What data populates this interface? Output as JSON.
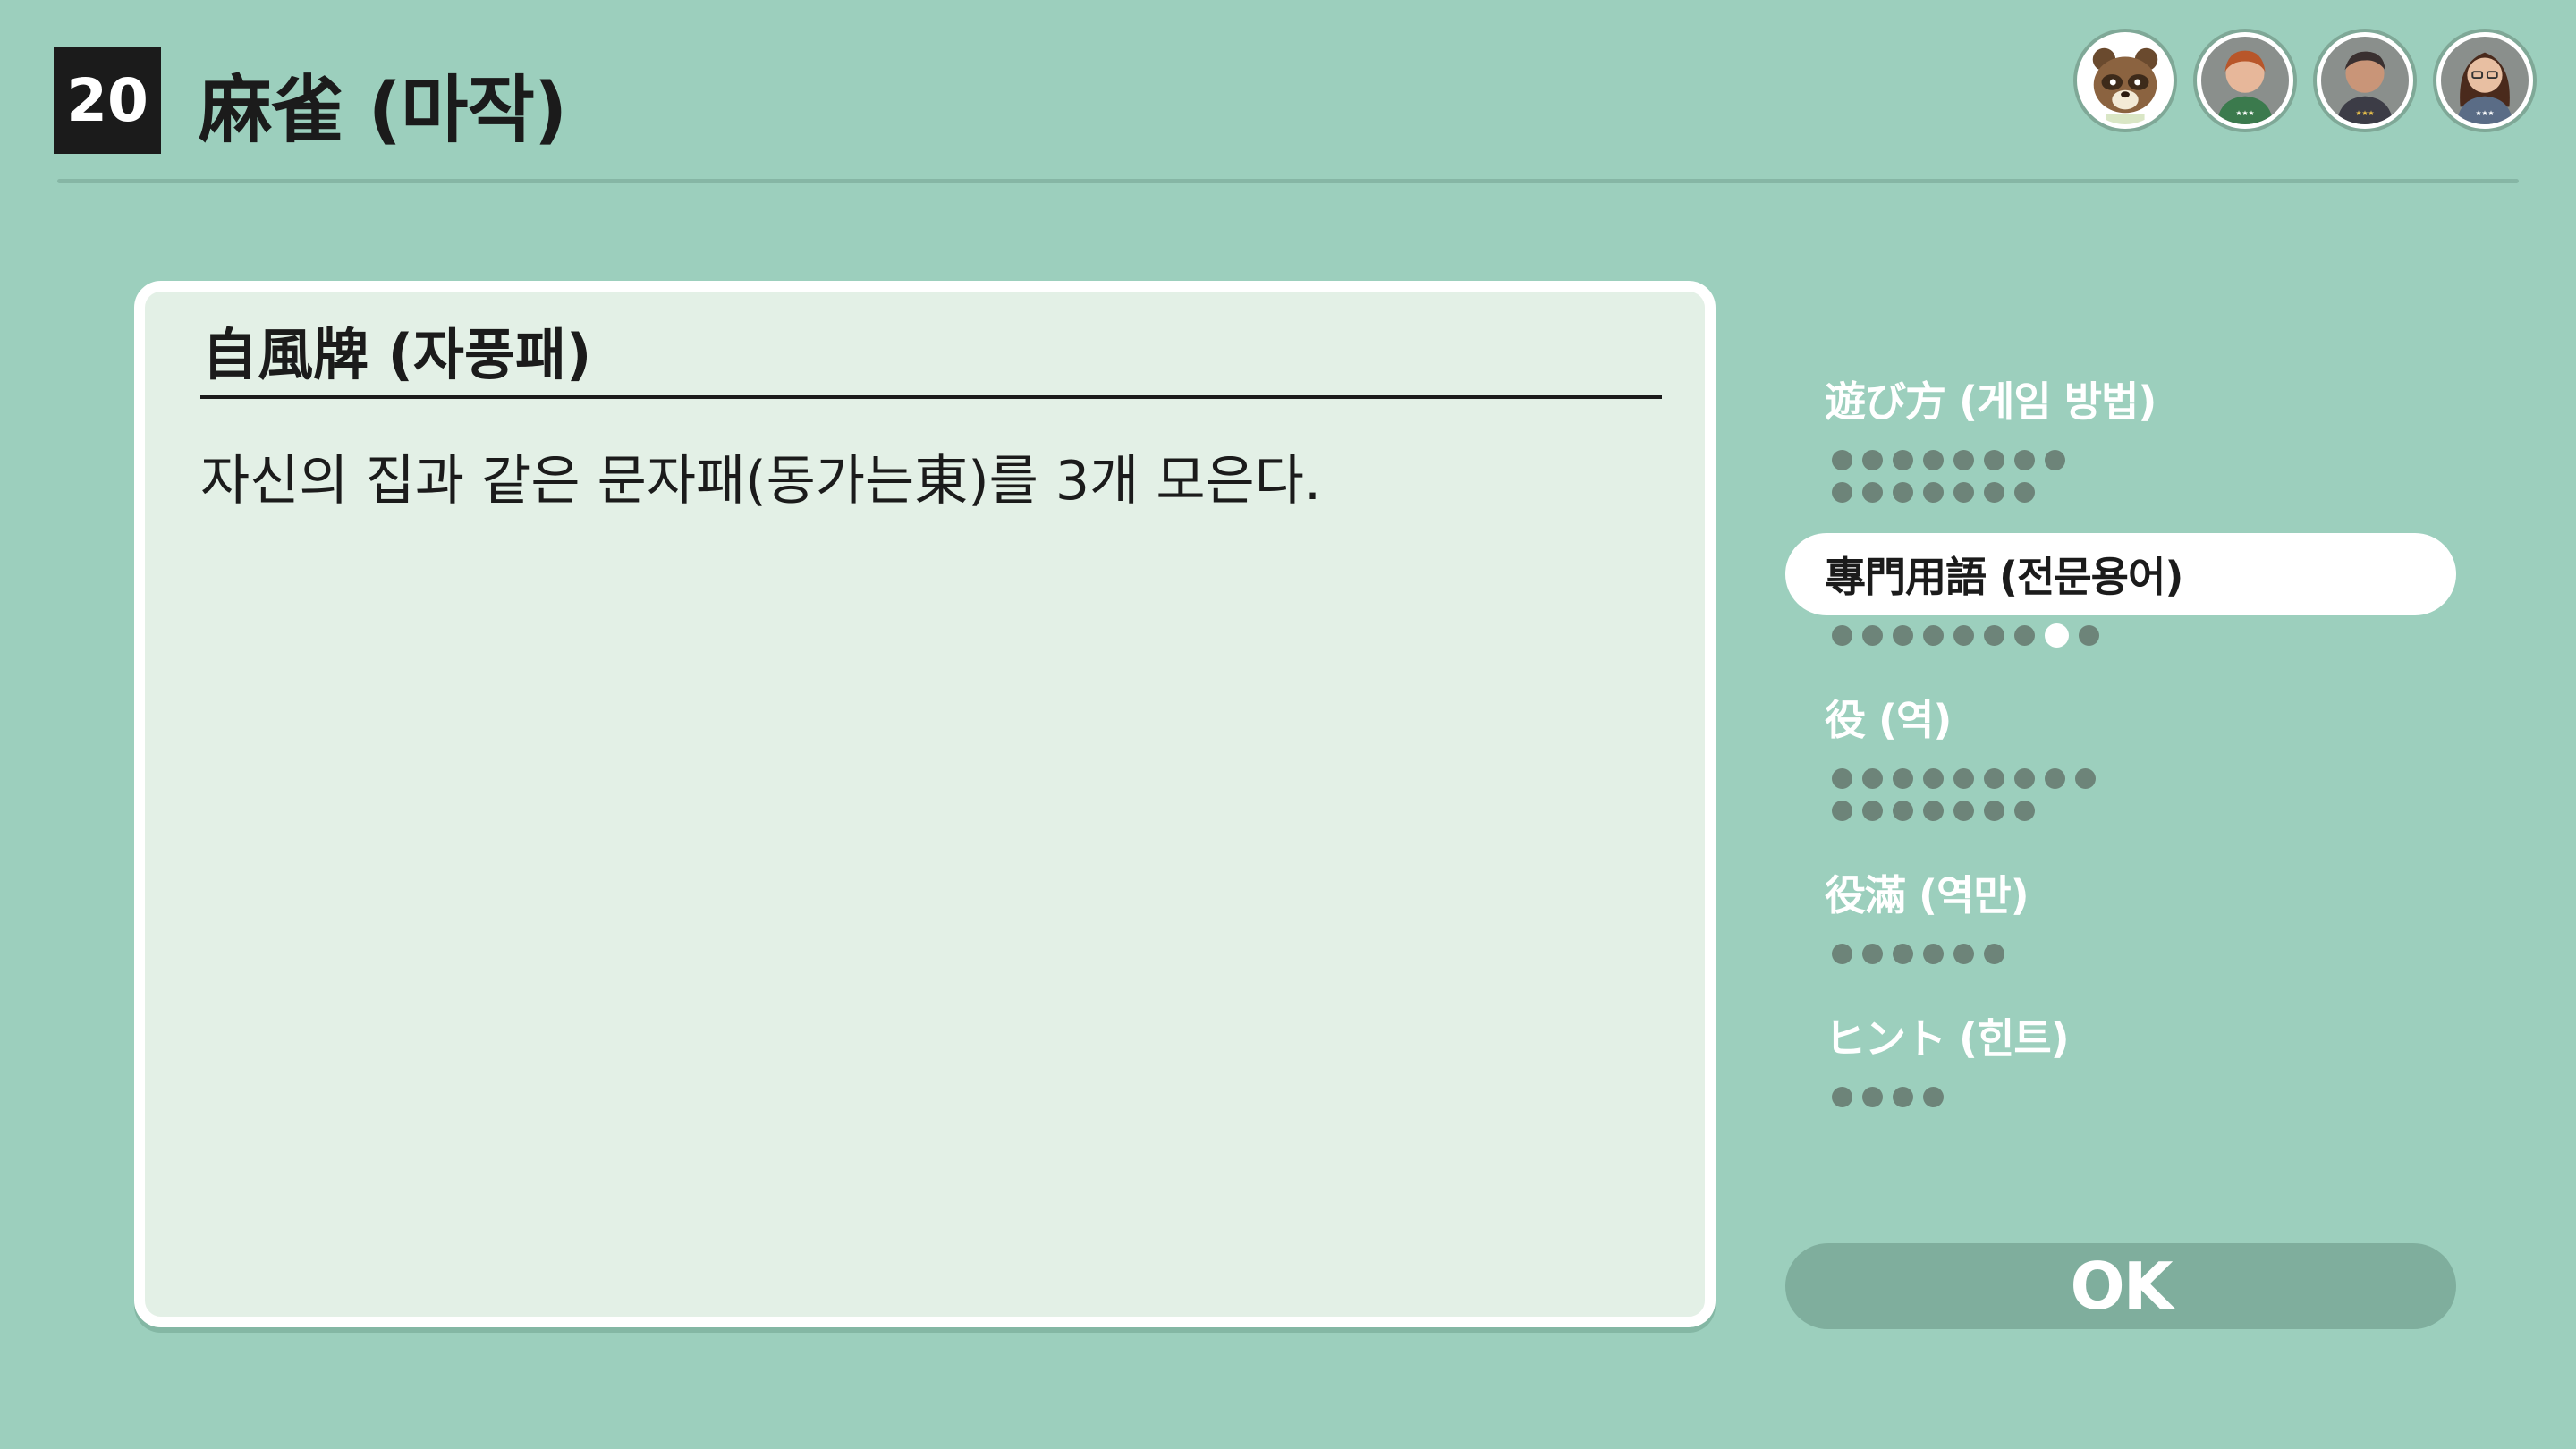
{
  "header": {
    "number": "20",
    "title": "麻雀 (마작)"
  },
  "players": [
    {
      "name": "raccoon-player-avatar-icon"
    },
    {
      "name": "cpu-player-avatar-icon"
    },
    {
      "name": "cpu-player-avatar-icon"
    },
    {
      "name": "cpu-player-avatar-icon"
    }
  ],
  "panel": {
    "title": "自風牌 (자풍패)",
    "body": "자신의 집과 같은 문자패(동가는東)를 3개 모은다."
  },
  "menu": {
    "items": [
      {
        "label": "遊び方 (게임 방법)",
        "active": false,
        "dot_rows": [
          8,
          7
        ],
        "current_dot": null
      },
      {
        "label": "專門用語 (전문용어)",
        "active": true,
        "dot_rows": [
          9
        ],
        "current_dot": 7
      },
      {
        "label": "役 (역)",
        "active": false,
        "dot_rows": [
          9,
          7
        ],
        "current_dot": null
      },
      {
        "label": "役滿 (역만)",
        "active": false,
        "dot_rows": [
          6
        ],
        "current_dot": null
      },
      {
        "label": "ヒント (힌트)",
        "active": false,
        "dot_rows": [
          4
        ],
        "current_dot": null
      }
    ]
  },
  "ok_button": {
    "label": "OK"
  },
  "colors": {
    "background": "#9ccfbd",
    "panel": "#e3f0e6",
    "dot": "#6d8479",
    "ok_button": "#7fae9d"
  }
}
